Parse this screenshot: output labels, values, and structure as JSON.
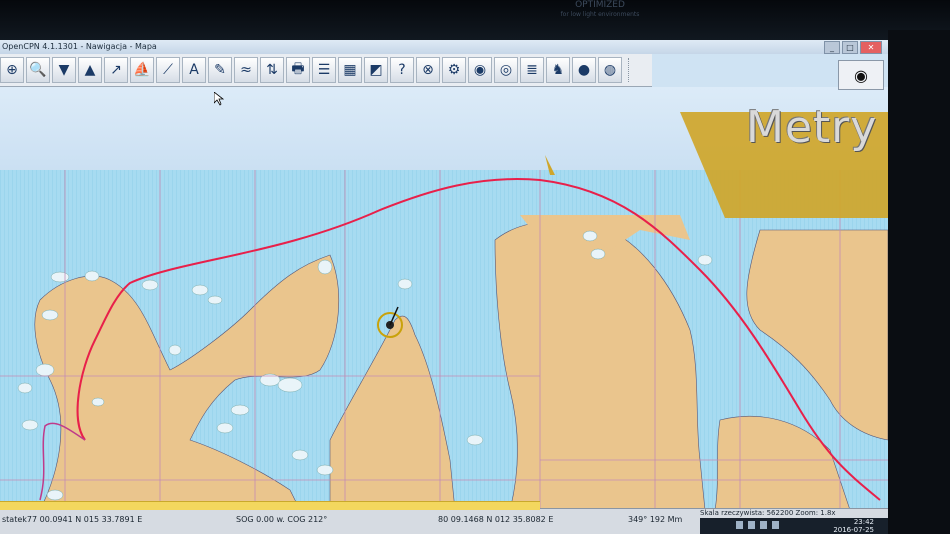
{
  "window": {
    "title": "OpenCPN 4.1.1301 - Nawigacja - Mapa",
    "buttons": [
      "_",
      "□",
      "✕"
    ]
  },
  "bezel": {
    "logo_text": "OPTIMIZED",
    "logo_sub": "for low light environments"
  },
  "toolbar": {
    "tools": [
      {
        "name": "zoom-in-icon",
        "glyph": "⊕"
      },
      {
        "name": "zoom-out-icon",
        "glyph": "🔍"
      },
      {
        "name": "scale-in-icon",
        "glyph": "▼"
      },
      {
        "name": "scale-out-icon",
        "glyph": "▲"
      },
      {
        "name": "route-icon",
        "glyph": "↗"
      },
      {
        "name": "ship-icon",
        "glyph": "⛵"
      },
      {
        "name": "measure-icon",
        "glyph": "⟋"
      },
      {
        "name": "text-icon",
        "glyph": "A"
      },
      {
        "name": "track-icon",
        "glyph": "✎"
      },
      {
        "name": "tide-icon",
        "glyph": "≈"
      },
      {
        "name": "current-icon",
        "glyph": "⇅"
      },
      {
        "name": "print-icon",
        "glyph": "🖶"
      },
      {
        "name": "route-manager-icon",
        "glyph": "☰"
      },
      {
        "name": "chart-quilt-icon",
        "glyph": "▦"
      },
      {
        "name": "color-scheme-icon",
        "glyph": "◩"
      },
      {
        "name": "help-icon",
        "glyph": "?"
      },
      {
        "name": "target-icon",
        "glyph": "⊗"
      },
      {
        "name": "settings-icon",
        "glyph": "⚙"
      },
      {
        "name": "ais-icon",
        "glyph": "◉"
      },
      {
        "name": "radar-icon",
        "glyph": "◎"
      },
      {
        "name": "list-icon",
        "glyph": "≣"
      },
      {
        "name": "dog-icon",
        "glyph": "♞"
      },
      {
        "name": "globe-icon",
        "glyph": "●"
      },
      {
        "name": "lifebuoy-icon",
        "glyph": "◍"
      }
    ]
  },
  "overlay": {
    "units_label": "Metry",
    "compass_glyph": "◉"
  },
  "status": {
    "cursor_pos": "statek77 00.0941 N  015 33.7891 E",
    "sog_cog": "SOG 0.00 w.  COG 212°",
    "ship_pos": "80 09.1468 N  012 35.8082 E",
    "bearing_dist": "349°  192 Mm",
    "scale_zoom": "Skala rzeczywista: 562200  Zoom: 1.8x"
  },
  "taskbar": {
    "time": "23:42",
    "date": "2016-07-25"
  },
  "colors": {
    "land": "#eac58d",
    "sea_shallow": "#9fd6ee",
    "sea_deep": "#bfe5f6",
    "route": "#e8204a",
    "grid": "#c58bb4",
    "units_panel": "#cfa62a"
  }
}
